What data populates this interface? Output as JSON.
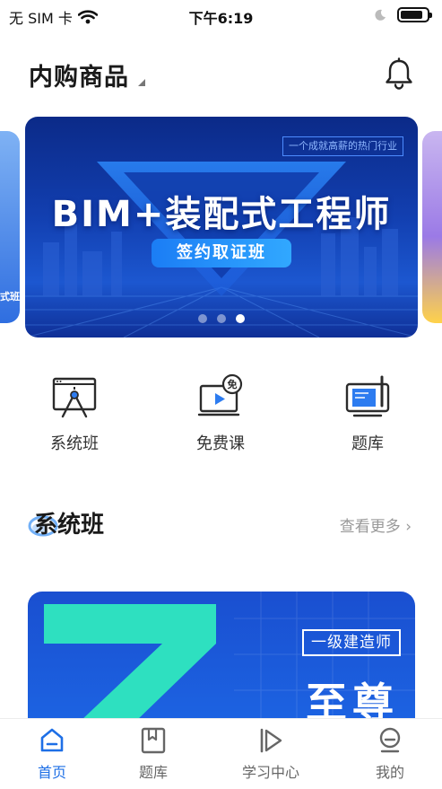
{
  "status_bar": {
    "carrier": "无 SIM 卡",
    "time": "下午6:19",
    "battery_level": 0.85
  },
  "header": {
    "title": "内购商品",
    "bell_icon": "bell-icon"
  },
  "banner": {
    "tagline": "一个成就高薪的热门行业",
    "title": "BIM+装配式工程师",
    "subtitle": "签约取证班",
    "peek_left_text": "式班",
    "page_count": 3,
    "active_page": 3
  },
  "quick_entries": [
    {
      "label": "系统班",
      "icon": "classroom-easel-icon"
    },
    {
      "label": "免费课",
      "icon": "free-video-icon"
    },
    {
      "label": "题库",
      "icon": "tablet-pen-icon"
    }
  ],
  "section": {
    "title": "系统班",
    "more": "查看更多 ›"
  },
  "course_card": {
    "badge": "一级建造师",
    "big_text": "至尊",
    "numeral": "7",
    "colors": {
      "background": "#1c5ad8",
      "numeral": "#2ee0c0"
    }
  },
  "tabbar": {
    "tabs": [
      {
        "label": "首页",
        "icon": "home-icon",
        "active": true
      },
      {
        "label": "题库",
        "icon": "bookmark-book-icon",
        "active": false
      },
      {
        "label": "学习中心",
        "icon": "play-icon",
        "active": false
      },
      {
        "label": "我的",
        "icon": "profile-icon",
        "active": false
      }
    ]
  },
  "colors": {
    "accent": "#1e6fe6",
    "inactive_tab": "#666666",
    "muted_text": "#999999"
  }
}
